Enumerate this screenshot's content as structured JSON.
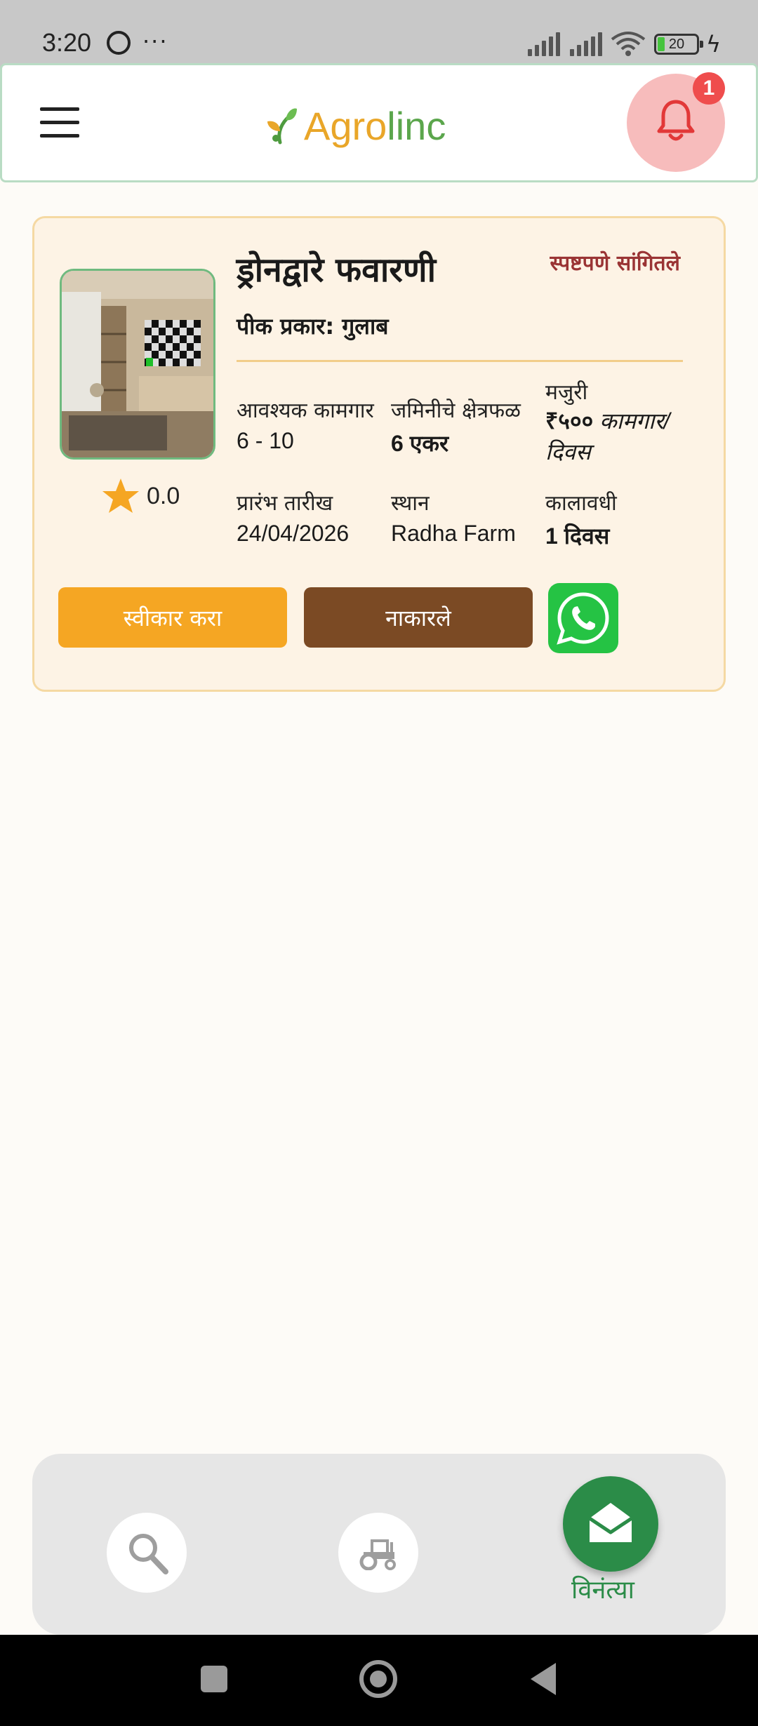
{
  "status_bar": {
    "time": "3:20",
    "dots": "···",
    "battery": "20"
  },
  "header": {
    "logo_part1": "Agro",
    "logo_part2": "linc",
    "notification_count": "1",
    "logo_colors": [
      "#e9a629",
      "#5ba64c"
    ]
  },
  "request_card": {
    "title": "ड्रोनद्वारे फवारणी",
    "status": "स्पष्टपणे सांगितले",
    "crop_type": "पीक प्रकार: गुलाब",
    "rating": "0.0",
    "fields": {
      "workers_label": "आवश्यक कामगार",
      "workers_value": "6 - 10",
      "area_label": "जमिनीचे क्षेत्रफळ",
      "area_value": "6 एकर",
      "wage_label": "मजुरी",
      "wage_amount": "₹५००",
      "wage_unit": "कामगार/ दिवस",
      "start_label": "प्रारंभ तारीख",
      "start_value": "24/04/2026",
      "location_label": "स्थान",
      "location_value": "Radha Farm",
      "duration_label": "कालावधी",
      "duration_value": "1 दिवस"
    },
    "accept_label": "स्वीकार करा",
    "reject_label": "नाकारले"
  },
  "bottom_nav": {
    "items": [
      {
        "icon": "search-icon",
        "active": false
      },
      {
        "icon": "tractor-icon",
        "active": false
      },
      {
        "icon": "envelope-open-icon",
        "active": true,
        "label": "विनंत्या"
      }
    ]
  },
  "colors": {
    "accent_green": "#2b8c48",
    "accept": "#f5a623",
    "reject": "#7b4a24",
    "status_red": "#9a3434"
  }
}
